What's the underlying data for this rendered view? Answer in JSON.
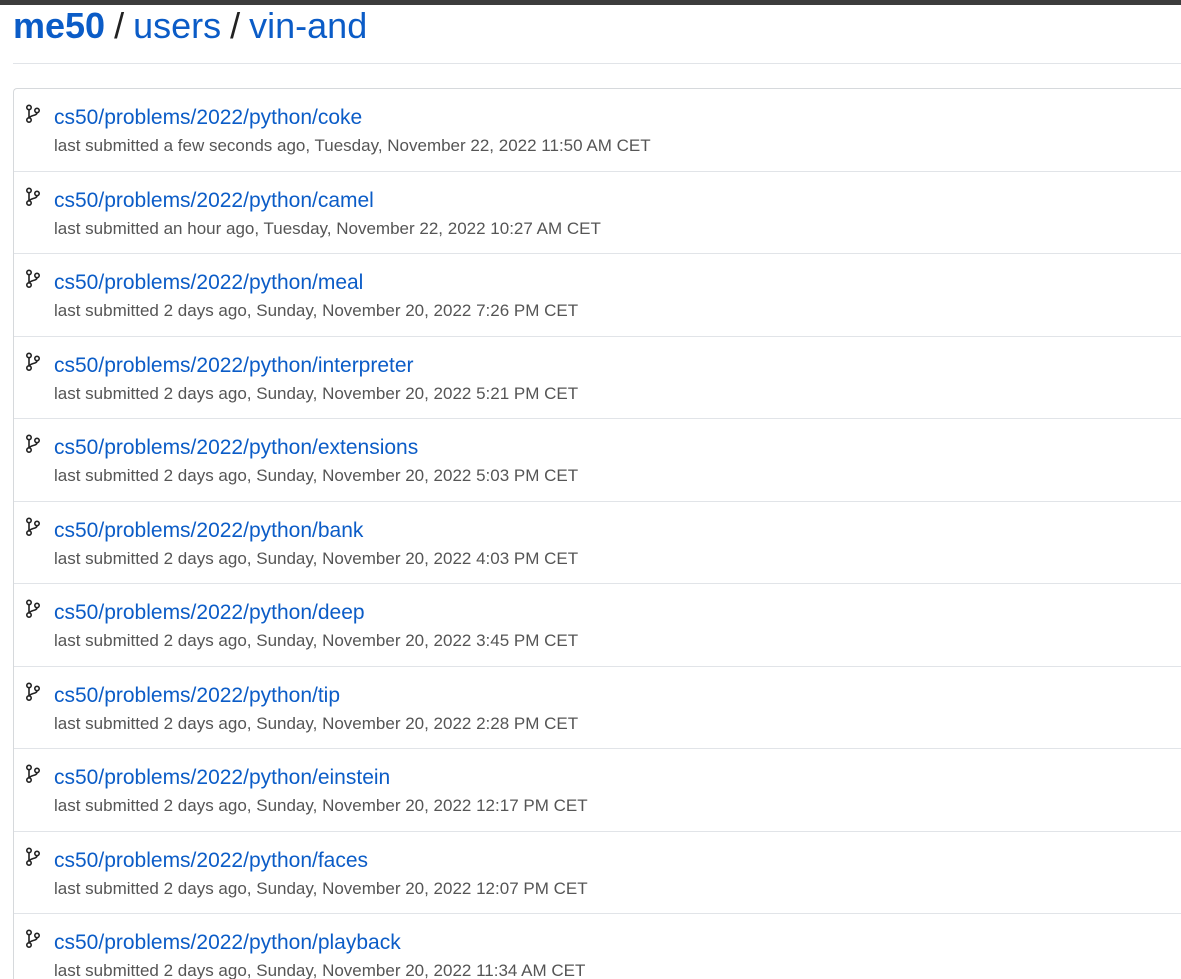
{
  "breadcrumb": {
    "root": "me50",
    "separator": "/",
    "users": "users",
    "user": "vin-and"
  },
  "submissions": [
    {
      "title": "cs50/problems/2022/python/coke",
      "meta": "last submitted a few seconds ago, Tuesday, November 22, 2022 11:50 AM CET"
    },
    {
      "title": "cs50/problems/2022/python/camel",
      "meta": "last submitted an hour ago, Tuesday, November 22, 2022 10:27 AM CET"
    },
    {
      "title": "cs50/problems/2022/python/meal",
      "meta": "last submitted 2 days ago, Sunday, November 20, 2022 7:26 PM CET"
    },
    {
      "title": "cs50/problems/2022/python/interpreter",
      "meta": "last submitted 2 days ago, Sunday, November 20, 2022 5:21 PM CET"
    },
    {
      "title": "cs50/problems/2022/python/extensions",
      "meta": "last submitted 2 days ago, Sunday, November 20, 2022 5:03 PM CET"
    },
    {
      "title": "cs50/problems/2022/python/bank",
      "meta": "last submitted 2 days ago, Sunday, November 20, 2022 4:03 PM CET"
    },
    {
      "title": "cs50/problems/2022/python/deep",
      "meta": "last submitted 2 days ago, Sunday, November 20, 2022 3:45 PM CET"
    },
    {
      "title": "cs50/problems/2022/python/tip",
      "meta": "last submitted 2 days ago, Sunday, November 20, 2022 2:28 PM CET"
    },
    {
      "title": "cs50/problems/2022/python/einstein",
      "meta": "last submitted 2 days ago, Sunday, November 20, 2022 12:17 PM CET"
    },
    {
      "title": "cs50/problems/2022/python/faces",
      "meta": "last submitted 2 days ago, Sunday, November 20, 2022 12:07 PM CET"
    },
    {
      "title": "cs50/problems/2022/python/playback",
      "meta": "last submitted 2 days ago, Sunday, November 20, 2022 11:34 AM CET"
    }
  ],
  "icons": {
    "row_icon": "git-branch-icon"
  },
  "colors": {
    "link": "#0b5cc7",
    "meta_text": "#555555",
    "border": "#e1e4e8"
  }
}
